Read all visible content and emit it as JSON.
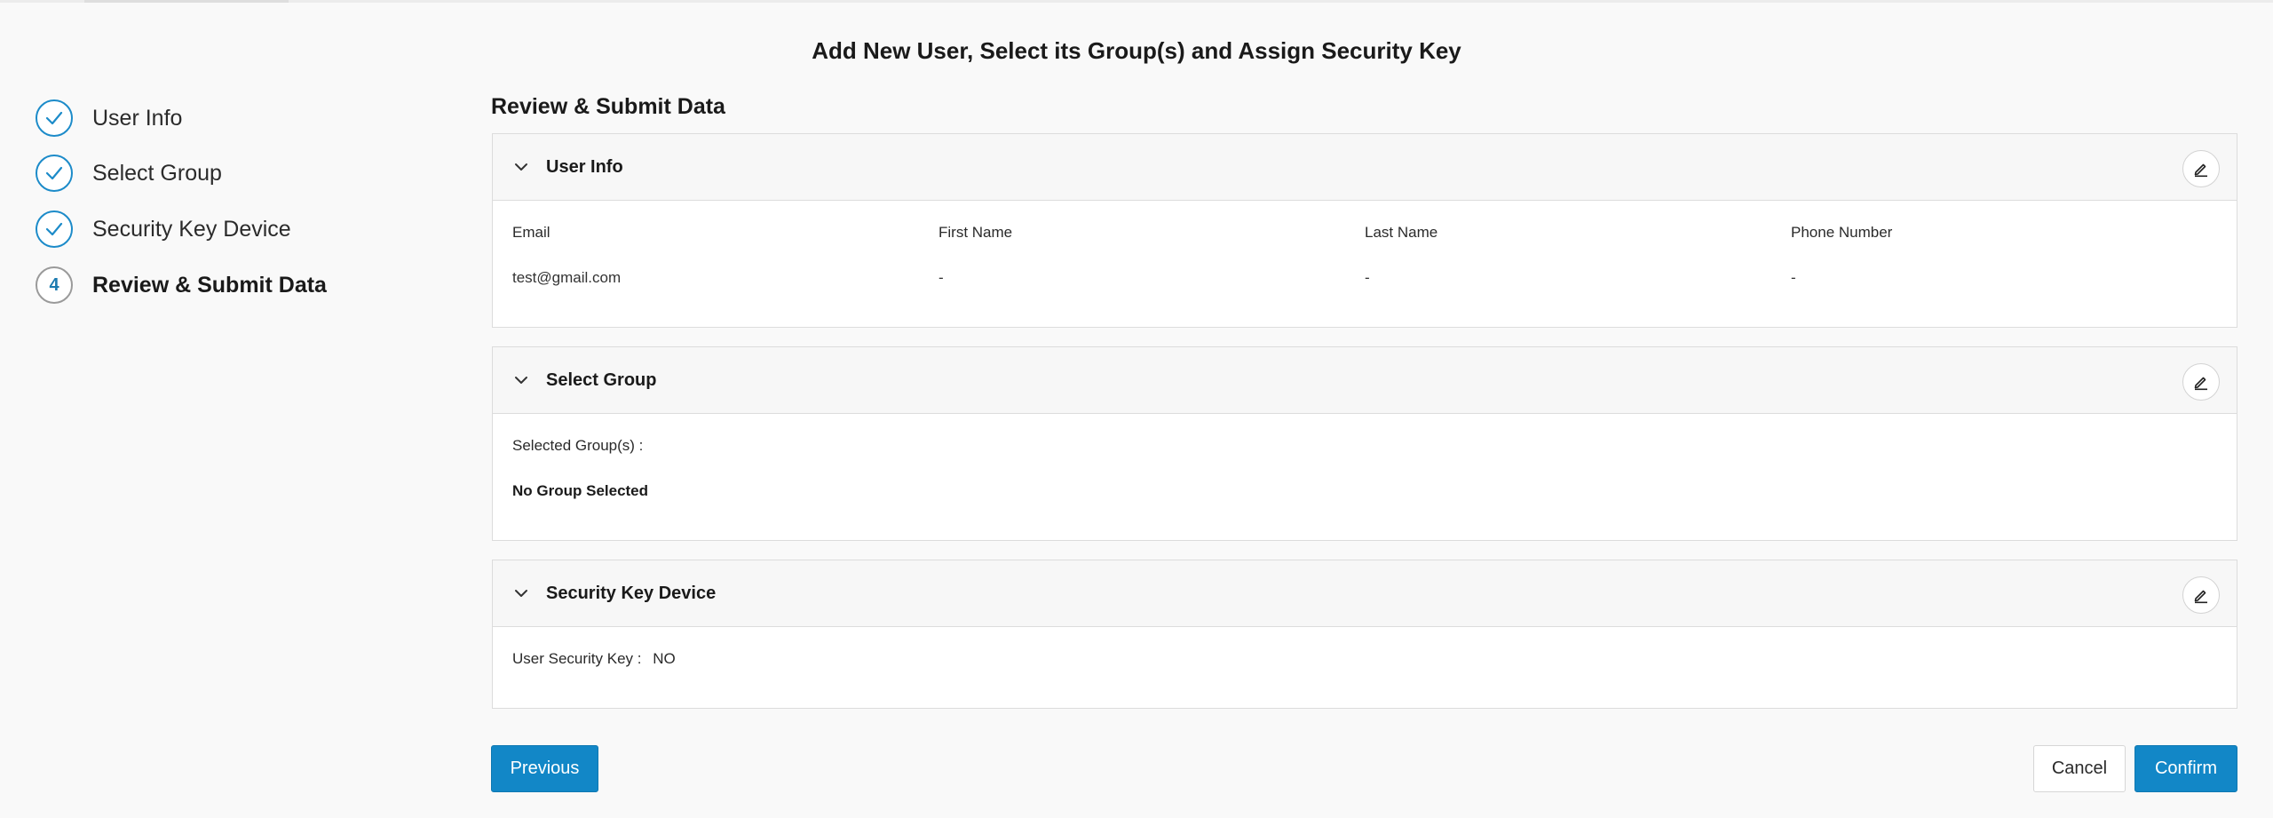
{
  "page": {
    "title": "Add New User, Select its Group(s) and Assign Security Key",
    "accent_color": "#1287c7"
  },
  "stepper": {
    "steps": [
      {
        "label": "User Info",
        "status": "completed",
        "icon": "check-icon"
      },
      {
        "label": "Select Group",
        "status": "completed",
        "icon": "check-icon"
      },
      {
        "label": "Security Key Device",
        "status": "completed",
        "icon": "check-icon"
      },
      {
        "label": "Review & Submit Data",
        "status": "current",
        "number": "4"
      }
    ]
  },
  "review": {
    "heading": "Review & Submit Data",
    "user_info": {
      "title": "User Info",
      "columns": [
        {
          "label": "Email",
          "value": "test@gmail.com"
        },
        {
          "label": "First Name",
          "value": "-"
        },
        {
          "label": "Last Name",
          "value": "-"
        },
        {
          "label": "Phone Number",
          "value": "-"
        }
      ]
    },
    "select_group": {
      "title": "Select Group",
      "label": "Selected Group(s) :",
      "value": "No Group Selected"
    },
    "security_key": {
      "title": "Security Key Device",
      "label": "User Security Key :",
      "value": "NO"
    }
  },
  "footer": {
    "previous_label": "Previous",
    "cancel_label": "Cancel",
    "confirm_label": "Confirm"
  }
}
